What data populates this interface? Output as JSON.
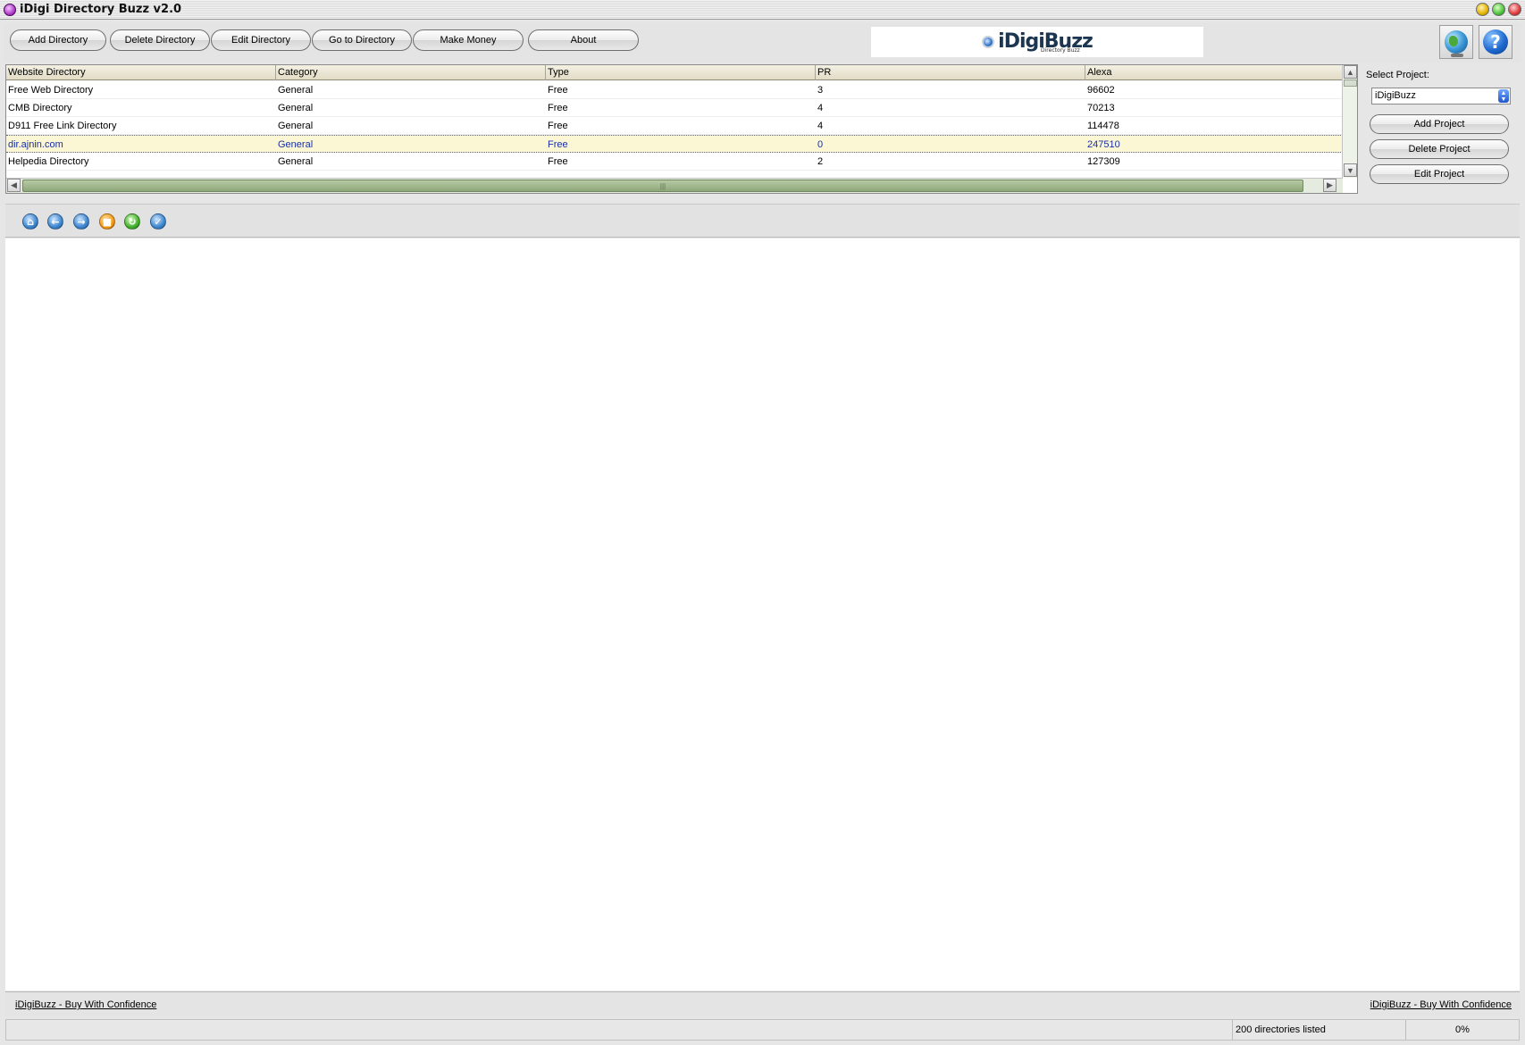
{
  "window": {
    "title": "iDigi Directory Buzz v2.0"
  },
  "toolbar": {
    "buttons": [
      "Add Directory",
      "Delete Directory",
      "Edit Directory",
      "Go to Directory",
      "Make Money",
      "About"
    ],
    "logo_text": "iDigiBuzz",
    "logo_subtext": "Directory Buzz"
  },
  "table": {
    "columns": [
      "Website Directory",
      "Category",
      "Type",
      "PR",
      "Alexa"
    ],
    "rows": [
      [
        "Free Web Directory",
        "General",
        "Free",
        "3",
        "96602"
      ],
      [
        "CMB Directory",
        "General",
        "Free",
        "4",
        "70213"
      ],
      [
        "D911 Free Link Directory",
        "General",
        "Free",
        "4",
        "114478"
      ],
      [
        "dir.ajnin.com",
        "General",
        "Free",
        "0",
        "247510"
      ],
      [
        "Helpedia Directory",
        "General",
        "Free",
        "2",
        "127309"
      ]
    ],
    "selected_row": 3
  },
  "project": {
    "label": "Select Project:",
    "selected": "iDigiBuzz",
    "buttons": [
      "Add Project",
      "Delete Project",
      "Edit Project"
    ]
  },
  "nav_icons": [
    "home-icon",
    "back-icon",
    "forward-icon",
    "stop-icon",
    "refresh-icon",
    "check-icon"
  ],
  "footer": {
    "left_link": "iDigiBuzz - Buy With Confidence",
    "right_link": "iDigiBuzz - Buy With Confidence"
  },
  "status": {
    "count_text": "200 directories listed",
    "progress_text": "0%"
  },
  "colors": {
    "selected_row_bg": "#fbf7d4",
    "selected_row_text": "#1a2fa0",
    "scrollbar_thumb": "#8ea77a"
  }
}
